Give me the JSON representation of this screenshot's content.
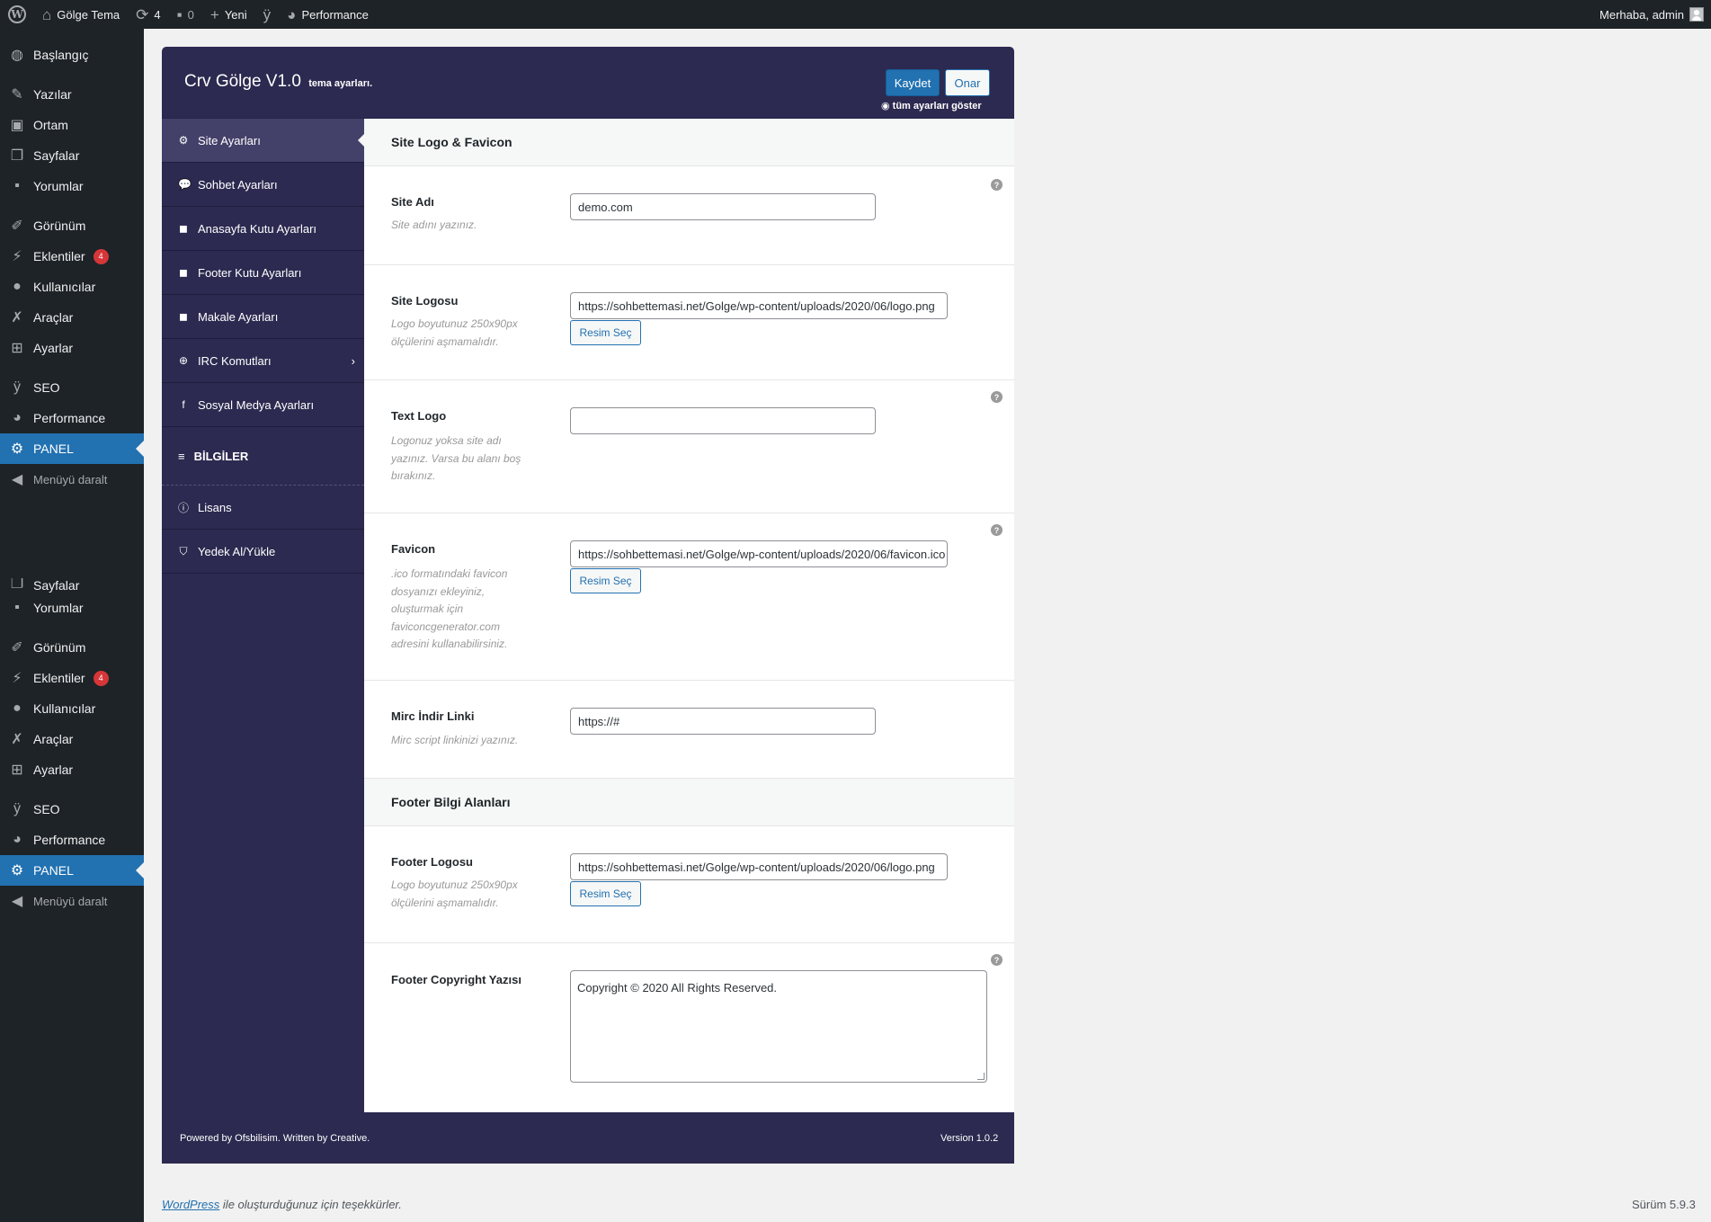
{
  "adminbar": {
    "site_name": "Gölge Tema",
    "updates_count": "4",
    "comments_count": "0",
    "new_label": "Yeni",
    "performance_label": "Performance",
    "greeting": "Merhaba, admin"
  },
  "menu": {
    "dashboard": "Başlangıç",
    "posts": "Yazılar",
    "media": "Ortam",
    "pages": "Sayfalar",
    "comments": "Yorumlar",
    "appearance": "Görünüm",
    "plugins": "Eklentiler",
    "plugins_badge": "4",
    "users": "Kullanıcılar",
    "tools": "Araçlar",
    "settings": "Ayarlar",
    "seo": "SEO",
    "performance": "Performance",
    "panel": "PANEL",
    "collapse": "Menüyü daralt"
  },
  "panel": {
    "title": "Crv Gölge V1.0",
    "subtitle": "tema ayarları.",
    "save_label": "Kaydet",
    "reset_label": "Onar",
    "show_all_label": "tüm ayarları göster",
    "nav": {
      "site": "Site Ayarları",
      "chat": "Sohbet Ayarları",
      "home_box": "Anasayfa Kutu Ayarları",
      "footer_box": "Footer Kutu Ayarları",
      "article": "Makale Ayarları",
      "irc": "IRC Komutları",
      "social": "Sosyal Medya Ayarları",
      "info_section": "BİLGİLER",
      "license": "Lisans",
      "backup": "Yedek Al/Yükle"
    },
    "content": {
      "section1_title": "Site Logo & Favicon",
      "site_name_label": "Site Adı",
      "site_name_desc": "Site adını yazınız.",
      "site_name_value": "demo.com",
      "site_logo_label": "Site Logosu",
      "site_logo_desc": "Logo boyutunuz 250x90px ölçülerini aşmamalıdır.",
      "site_logo_value": "https://sohbettemasi.net/Golge/wp-content/uploads/2020/06/logo.png",
      "select_image_label": "Resim Seç",
      "text_logo_label": "Text Logo",
      "text_logo_desc": "Logonuz yoksa site adı yazınız. Varsa bu alanı boş bırakınız.",
      "text_logo_value": "",
      "favicon_label": "Favicon",
      "favicon_desc": ".ico formatındaki favicon dosyanızı ekleyiniz, oluşturmak için faviconcgenerator.com adresini kullanabilirsiniz.",
      "favicon_value": "https://sohbettemasi.net/Golge/wp-content/uploads/2020/06/favicon.ico",
      "mirc_label": "Mirc İndir Linki",
      "mirc_desc": "Mirc script linkinizi yazınız.",
      "mirc_value": "https://#",
      "section2_title": "Footer Bilgi Alanları",
      "footer_logo_label": "Footer Logosu",
      "footer_logo_desc": "Logo boyutunuz 250x90px ölçülerini aşmamalıdır.",
      "footer_logo_value": "https://sohbettemasi.net/Golge/wp-content/uploads/2020/06/logo.png",
      "copyright_label": "Footer Copyright Yazısı",
      "copyright_value": "Copyright © 2020 All Rights Reserved.",
      "help_glyph": "?"
    },
    "footer": {
      "credit": "Powered by Ofsbilisim. Written by Creative.",
      "version": "Version 1.0.2"
    }
  },
  "wpfooter": {
    "link": "WordPress",
    "thanks": "ile oluşturduğunuz için teşekkürler.",
    "version": "Sürüm 5.9.3"
  },
  "colors": {
    "panel_bg": "#2c2a50",
    "nav_active": "#434069",
    "accent": "#2271b1",
    "admin_dark": "#1d2327",
    "badge": "#d63638"
  }
}
